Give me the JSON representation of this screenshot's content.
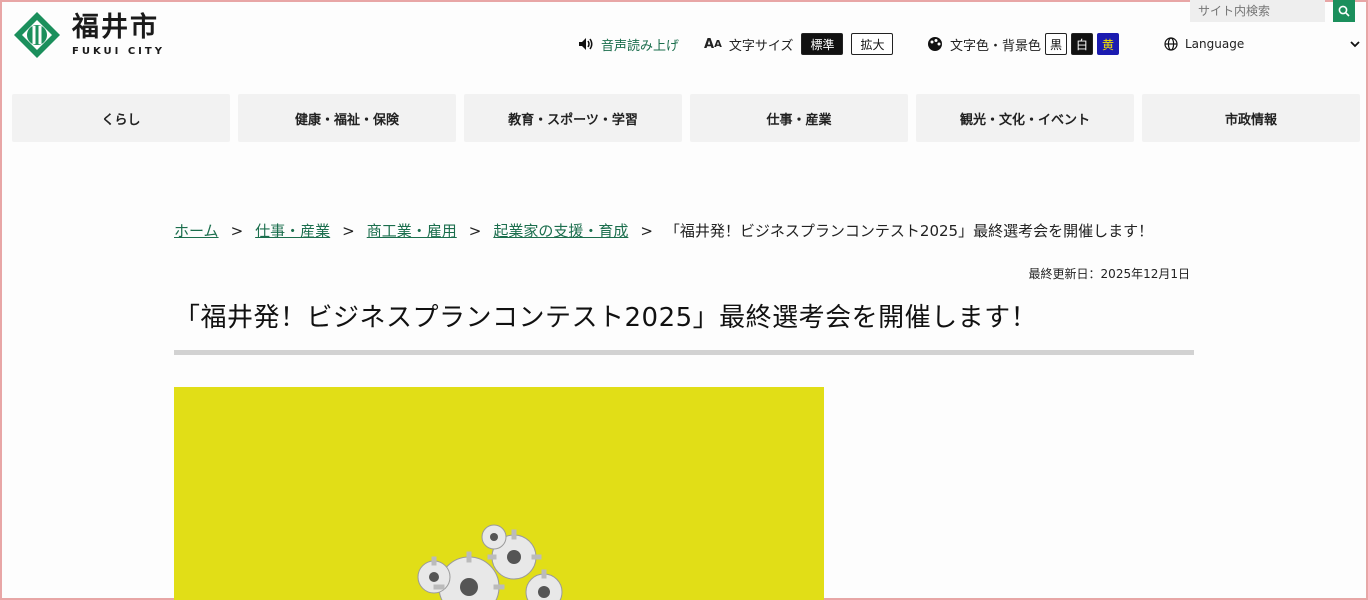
{
  "site": {
    "name_kanji": "福井市",
    "name_roman": "FUKUI CITY"
  },
  "utility": {
    "speech_label": "音声読み上げ",
    "font_size_label": "文字サイズ",
    "font_size_options": [
      "標準",
      "拡大"
    ],
    "color_label": "文字色・背景色",
    "color_options": [
      "黒",
      "白",
      "黄"
    ],
    "language_label": "Language"
  },
  "search": {
    "placeholder": "サイト内検索"
  },
  "nav": {
    "items": [
      "くらし",
      "健康・福祉・保険",
      "教育・スポーツ・学習",
      "仕事・産業",
      "観光・文化・イベント",
      "市政情報"
    ]
  },
  "breadcrumb": {
    "items": [
      "ホーム",
      "仕事・産業",
      "商工業・雇用",
      "起業家の支援・育成"
    ],
    "separator": ">",
    "current": "「福井発！ビジネスプランコンテスト2025」最終選考会を開催します！"
  },
  "page": {
    "updated": "最終更新日：2025年12月1日",
    "title": "「福井発！ビジネスプランコンテスト2025」最終選考会を開催します！"
  },
  "colors": {
    "accent_green": "#1b8f5c",
    "link_green": "#1b6e4d",
    "hero_yellow": "#e1de17"
  }
}
